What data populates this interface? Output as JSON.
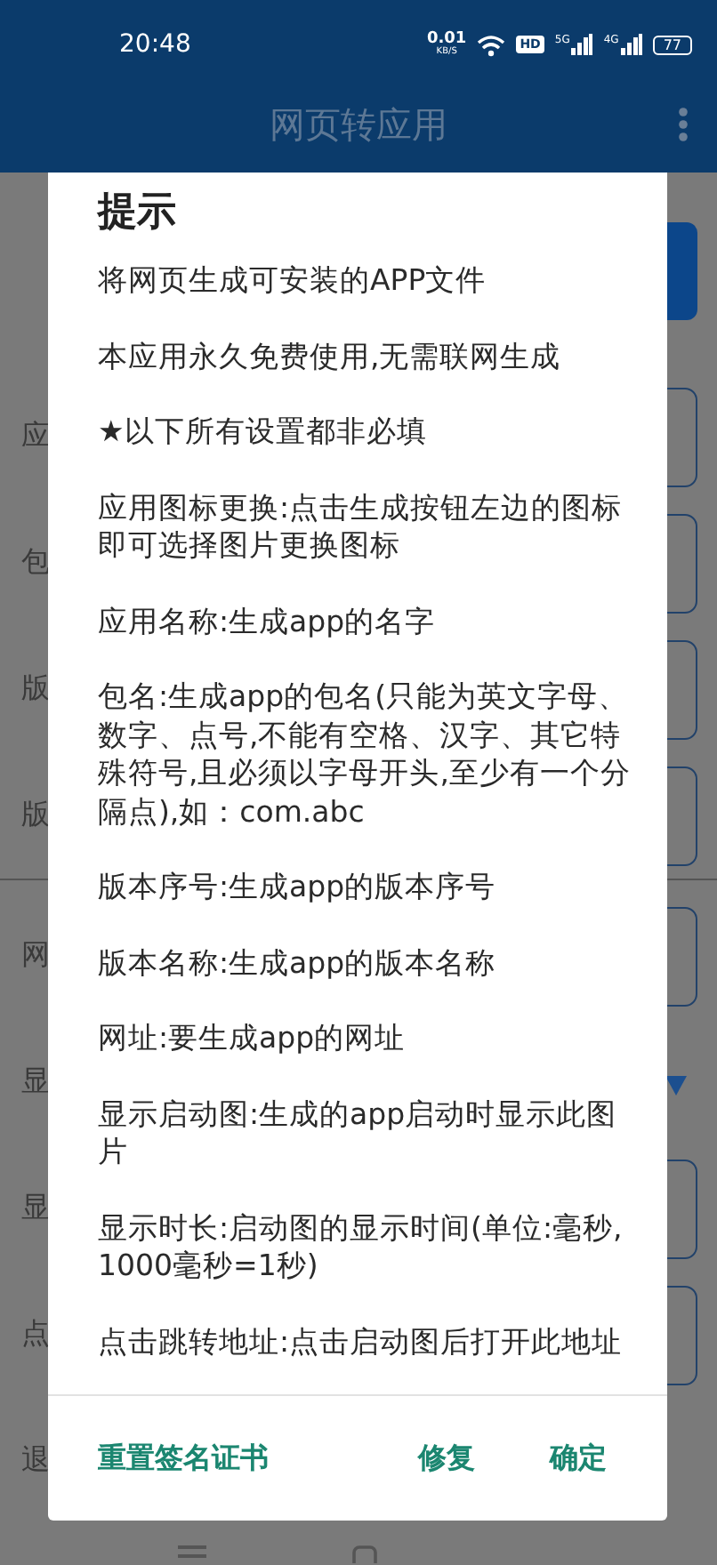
{
  "status_bar": {
    "time": "20:48",
    "net_speed": "0.01",
    "net_unit": "KB/S",
    "hd": "HD",
    "signals": [
      {
        "label": "5G"
      },
      {
        "label": "4G"
      }
    ],
    "battery": "77"
  },
  "app_bar": {
    "title": "网页转应用"
  },
  "form": {
    "groups": [
      [
        {
          "kind": "button"
        },
        {
          "kind": "field",
          "label": "应"
        },
        {
          "kind": "field",
          "label": "包"
        },
        {
          "kind": "field",
          "label": "版"
        },
        {
          "kind": "field",
          "label": "版"
        }
      ],
      [
        {
          "kind": "field",
          "label": "网"
        },
        {
          "kind": "dropdown",
          "label": "显"
        },
        {
          "kind": "field",
          "label": "显"
        },
        {
          "kind": "field",
          "label": "点"
        },
        {
          "kind": "plain",
          "label": "退"
        }
      ]
    ]
  },
  "dialog": {
    "title": "提示",
    "paragraphs": [
      "将网页生成可安装的APP文件",
      "本应用永久免费使用,无需联网生成",
      "★以下所有设置都非必填",
      "应用图标更换:点击生成按钮左边的图标即可选择图片更换图标",
      "应用名称:生成app的名字",
      "包名:生成app的包名(只能为英文字母、数字、点号,不能有空格、汉字、其它特殊符号,且必须以字母开头,至少有一个分隔点),如：com.abc",
      "版本序号:生成app的版本序号",
      "版本名称:生成app的版本名称",
      "网址:要生成app的网址",
      "显示启动图:生成的app启动时显示此图片",
      "显示时长:启动图的显示时间(单位:毫秒,1000毫秒=1秒)",
      "点击跳转地址:点击启动图后打开此地址"
    ],
    "buttons": [
      {
        "label": "重置签名证书",
        "kind": "neutral"
      },
      {
        "label": "修复",
        "kind": "negative"
      },
      {
        "label": "确定",
        "kind": "positive"
      }
    ]
  }
}
